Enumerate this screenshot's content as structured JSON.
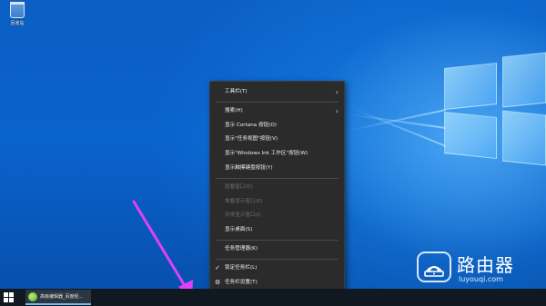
{
  "desktop": {
    "recycle_bin_label": "回收站"
  },
  "context_menu": {
    "items": [
      {
        "label": "工具栏(T)",
        "submenu": true,
        "disabled": false
      },
      {
        "separator": true
      },
      {
        "label": "搜索(H)",
        "submenu": true,
        "disabled": false
      },
      {
        "label": "显示 Cortana 按钮(O)",
        "disabled": false
      },
      {
        "label": "显示\"任务视图\"按钮(V)",
        "disabled": false
      },
      {
        "label": "显示\"Windows Ink 工作区\"按钮(W)",
        "disabled": false
      },
      {
        "label": "显示触摸键盘按钮(Y)",
        "disabled": false
      },
      {
        "separator": true
      },
      {
        "label": "层叠窗口(D)",
        "disabled": true
      },
      {
        "label": "堆叠显示窗口(E)",
        "disabled": true
      },
      {
        "label": "并排显示窗口(I)",
        "disabled": true
      },
      {
        "label": "显示桌面(S)",
        "disabled": false
      },
      {
        "separator": true
      },
      {
        "label": "任务管理器(K)",
        "disabled": false
      },
      {
        "separator": true
      },
      {
        "label": "锁定任务栏(L)",
        "checked": true,
        "disabled": false
      },
      {
        "label": "任务栏设置(T)",
        "icon": "gear-icon",
        "disabled": false
      }
    ]
  },
  "taskbar": {
    "start_icon": "windows-start-icon",
    "app_label": "高级编辑器_百度经...",
    "app_icon": "browser-icon"
  },
  "watermark": {
    "title": "路由器",
    "url": "luyouqi.com"
  },
  "colors": {
    "desktop_blue": "#0a62cc",
    "menu_bg": "#2b2b2b",
    "taskbar_bg": "#101820",
    "annotation_arrow": "#e040fb"
  }
}
